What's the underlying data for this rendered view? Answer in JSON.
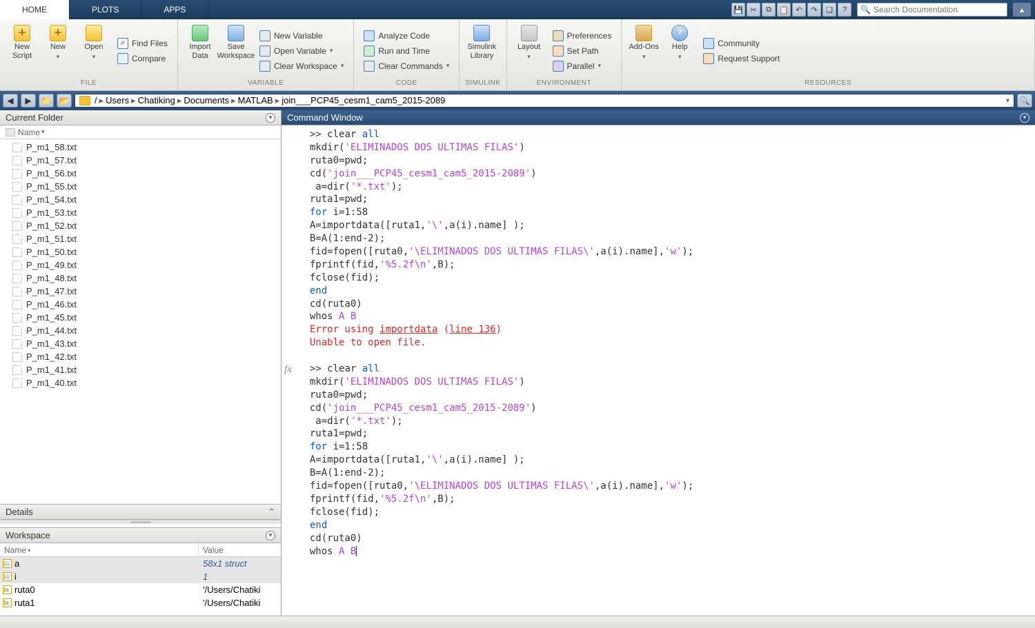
{
  "tabs": {
    "home": "HOME",
    "plots": "PLOTS",
    "apps": "APPS"
  },
  "search_placeholder": "Search Documentation",
  "toolstrip": {
    "file": {
      "label": "FILE",
      "new_script": "New\nScript",
      "new": "New",
      "open": "Open",
      "find_files": "Find Files",
      "compare": "Compare"
    },
    "variable": {
      "label": "VARIABLE",
      "import_data": "Import\nData",
      "save_ws": "Save\nWorkspace",
      "new_var": "New Variable",
      "open_var": "Open Variable",
      "clear_ws": "Clear Workspace"
    },
    "code": {
      "label": "CODE",
      "analyze": "Analyze Code",
      "run_time": "Run and Time",
      "clear_cmd": "Clear Commands"
    },
    "simulink": {
      "label": "SIMULINK",
      "lib": "Simulink\nLibrary"
    },
    "environment": {
      "label": "ENVIRONMENT",
      "layout": "Layout",
      "prefs": "Preferences",
      "set_path": "Set Path",
      "parallel": "Parallel"
    },
    "resources": {
      "label": "RESOURCES",
      "addons": "Add-Ons",
      "help": "Help",
      "community": "Community",
      "req_support": "Request Support"
    }
  },
  "breadcrumb": [
    "/",
    "Users",
    "Chatiking",
    "Documents",
    "MATLAB",
    "join___PCP45_cesm1_cam5_2015-2089"
  ],
  "panels": {
    "current_folder": "Current Folder",
    "cf_name_col": "Name",
    "details": "Details",
    "workspace": "Workspace",
    "ws_name_col": "Name",
    "ws_value_col": "Value",
    "command_window": "Command Window"
  },
  "files": [
    "P_m1_58.txt",
    "P_m1_57.txt",
    "P_m1_56.txt",
    "P_m1_55.txt",
    "P_m1_54.txt",
    "P_m1_53.txt",
    "P_m1_52.txt",
    "P_m1_51.txt",
    "P_m1_50.txt",
    "P_m1_49.txt",
    "P_m1_48.txt",
    "P_m1_47.txt",
    "P_m1_46.txt",
    "P_m1_45.txt",
    "P_m1_44.txt",
    "P_m1_43.txt",
    "P_m1_42.txt",
    "P_m1_41.txt",
    "P_m1_40.txt"
  ],
  "workspace": [
    {
      "name": "a",
      "value": "58x1 struct",
      "type": "struct",
      "sel": true
    },
    {
      "name": "i",
      "value": "1",
      "type": "num",
      "sel": true
    },
    {
      "name": "ruta0",
      "value": "'/Users/Chatiki",
      "type": "str",
      "sel": false
    },
    {
      "name": "ruta1",
      "value": "'/Users/Chatiki",
      "type": "str",
      "sel": false
    }
  ],
  "cmd": {
    "p": ">> ",
    "clear": "clear ",
    "all": "all",
    "l1": "mkdir(",
    "s1": "'ELIMINADOS DOS ULTIMAS FILAS'",
    "l1b": ")",
    "l2": "ruta0=pwd;",
    "l3": "cd(",
    "s3": "'join___PCP45_cesm1_cam5_2015-2089'",
    "l3b": ")",
    "l4": " a=dir(",
    "s4": "'*.txt'",
    "l4b": ");",
    "l5": "ruta1=pwd;",
    "for": "for ",
    "l6": "i=1:58",
    "l7a": "A=importdata([ruta1,",
    "s7": "'\\'",
    "l7b": ",a(i).name] );",
    "l8": "B=A(1:end-2);",
    "l9a": "fid=fopen([ruta0,",
    "s9": "'\\ELIMINADOS DOS ULTIMAS FILAS\\'",
    "l9b": ",a(i).name],",
    "s9c": "'w'",
    "l9d": ");",
    "l10a": "fprintf(fid,",
    "s10": "'%5.2f\\n'",
    "l10b": ",B);",
    "l11": "fclose(fid);",
    "end": "end",
    "l12": "cd(ruta0)",
    "l13a": "whos ",
    "l13b": "A B",
    "err1a": "Error using ",
    "err1b": "importdata",
    "err1c": " (",
    "err1d": "line 136",
    "err1e": ")",
    "err2": "Unable to open file."
  }
}
